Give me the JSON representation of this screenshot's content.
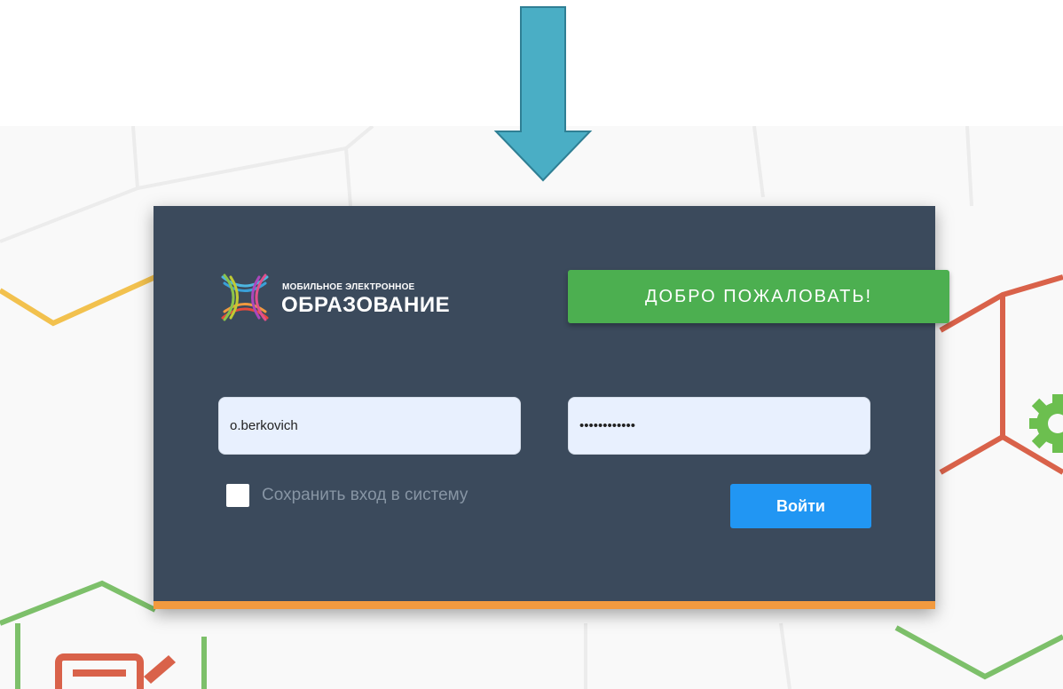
{
  "window": {
    "card_bg": "#3b4a5c",
    "accent_bottom": "#f29a3f"
  },
  "logo": {
    "line1": "МОБИЛЬНОЕ ЭЛЕКТРОННОЕ",
    "line2": "ОБРАЗОВАНИЕ"
  },
  "welcome": {
    "label": "ДОБРО ПОЖАЛОВАТЬ!",
    "color": "#4caf50"
  },
  "login_form": {
    "username_value": "o.berkovich",
    "password_value": "••••••••••••",
    "remember_label": "Сохранить вход в систему",
    "remember_checked": false,
    "submit_label": "Войти",
    "submit_color": "#2196f3"
  },
  "decorations": {
    "arrow_color": "#4aaec5",
    "hex_colors": [
      "#f2c14e",
      "#d9624a",
      "#7dc06a"
    ],
    "icons": [
      "down-arrow-icon",
      "gear-icon",
      "document-pencil-icon",
      "logo-mark-icon"
    ]
  }
}
